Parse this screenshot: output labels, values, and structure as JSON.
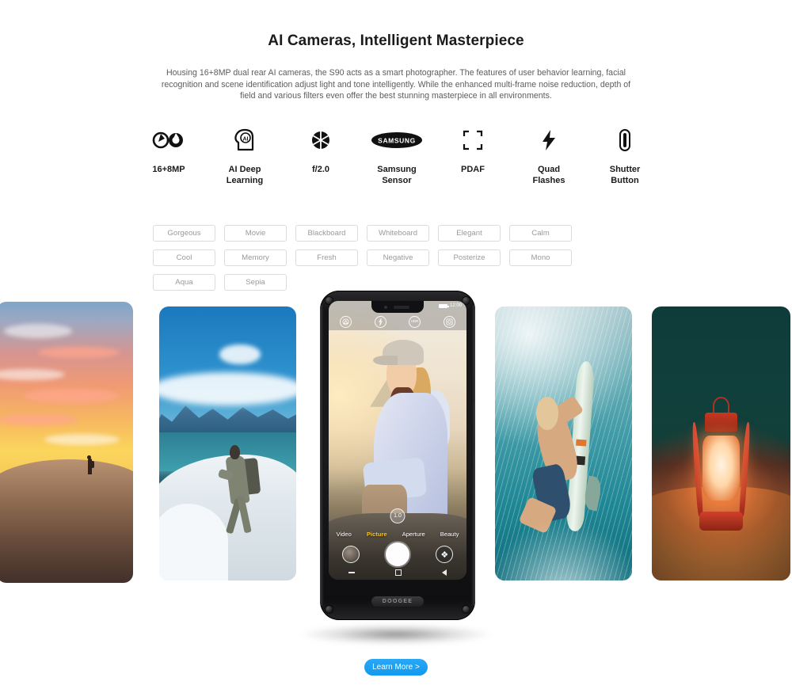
{
  "heading": {
    "title": "AI Cameras, Intelligent Masterpiece",
    "description": "Housing 16+8MP dual rear AI cameras, the S90 acts as a smart photographer. The features of user behavior learning, facial recognition and scene identification adjust light and tone intelligently. While the enhanced multi-frame noise reduction, depth of field and various filters even offer the best stunning masterpiece in all environments."
  },
  "features": [
    {
      "icon": "dual-aperture-icon",
      "label": "16+8MP"
    },
    {
      "icon": "ai-head-icon",
      "label": "AI Deep\nLearning"
    },
    {
      "icon": "aperture-icon",
      "label": "f/2.0"
    },
    {
      "icon": "samsung-logo-icon",
      "label": "Samsung\nSensor"
    },
    {
      "icon": "focus-brackets-icon",
      "label": "PDAF"
    },
    {
      "icon": "lightning-bolt-icon",
      "label": "Quad\nFlashes"
    },
    {
      "icon": "shutter-button-icon",
      "label": "Shutter\nButton"
    }
  ],
  "filters": [
    "Gorgeous",
    "Movie",
    "Blackboard",
    "Whiteboard",
    "Elegant",
    "Calm",
    "Cool",
    "Memory",
    "Fresh",
    "Negative",
    "Posterize",
    "Mono",
    "Aqua",
    "Sepia"
  ],
  "gallery": [
    {
      "name": "desert-sunset-photo",
      "caption": "Desert sunset with hiker silhouette on dune"
    },
    {
      "name": "mountain-hiker-photo",
      "caption": "Hiker with backpack on snowy mountain ridge"
    },
    {
      "name": "underwater-surfer-photo",
      "caption": "Surfer duck-diving underwater with surfboard"
    },
    {
      "name": "red-lantern-photo",
      "caption": "Glowing red oil lantern on sand at night"
    }
  ],
  "phone": {
    "brand": "DOOGEE",
    "status": {
      "time": "12:00",
      "battery": "battery-full-icon"
    },
    "top_controls": [
      {
        "name": "hdr-scene-icon",
        "glyph": "▲"
      },
      {
        "name": "flash-icon",
        "glyph": "⚡"
      },
      {
        "name": "hdr-icon",
        "glyph": "HDR"
      },
      {
        "name": "settings-camera-icon",
        "glyph": "▣"
      }
    ],
    "zoom_level": "1.0",
    "modes": [
      {
        "label": "Video",
        "active": false
      },
      {
        "label": "Picture",
        "active": true
      },
      {
        "label": "Aperture",
        "active": false
      },
      {
        "label": "Beauty",
        "active": false
      }
    ],
    "bottom_controls": {
      "gallery": "gallery-thumbnail-button",
      "shutter": "shutter-button",
      "filter": "filter-switch-button"
    },
    "nav": [
      "recents-button",
      "home-button",
      "back-button"
    ],
    "viewfinder_caption": "Smiling woman hiker in cap and light blue jacket at golden hour"
  },
  "cta": {
    "label": "Learn More >"
  },
  "colors": {
    "accent_blue": "#1499ef",
    "mode_active": "#f5c518",
    "chip_border": "#dcdcdc",
    "chip_text": "#9a9a9a",
    "title_text": "#1b1b1b",
    "body_text": "#5d5d5d"
  }
}
